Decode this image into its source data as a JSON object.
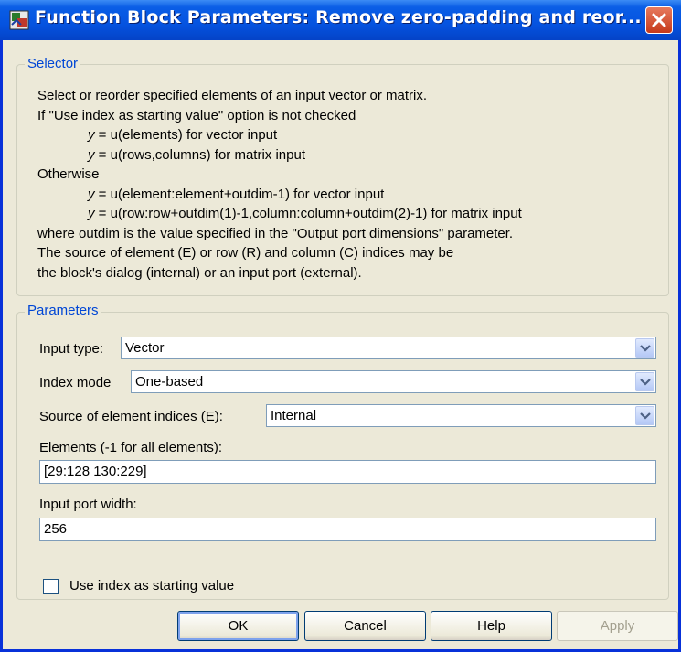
{
  "window": {
    "title": "Function Block Parameters: Remove  zero-padding and reor...",
    "close_icon": "close-icon",
    "app_icon": "simulink-block-icon"
  },
  "selector": {
    "group_label": "Selector",
    "lines": [
      "Select or reorder specified elements of an input vector or matrix.",
      "If \"Use index as starting value\" option is not checked",
      "y = u(elements) for vector input",
      "y = u(rows,columns) for matrix input",
      "Otherwise",
      "y = u(element:element+outdim-1) for vector input",
      "y = u(row:row+outdim(1)-1,column:column+outdim(2)-1) for matrix input",
      "where outdim is the value specified in the \"Output port dimensions\" parameter.",
      "The source of element (E) or row (R) and column (C) indices may be",
      "the block's dialog (internal) or an input port (external)."
    ]
  },
  "parameters": {
    "group_label": "Parameters",
    "input_type": {
      "label": "Input type:",
      "value": "Vector"
    },
    "index_mode": {
      "label": "Index mode",
      "value": "One-based"
    },
    "source_indices": {
      "label": "Source of element indices (E):",
      "value": "Internal"
    },
    "elements": {
      "label": "Elements (-1 for all elements):",
      "value": "[29:128 130:229]"
    },
    "port_width": {
      "label": "Input port width:",
      "value": "256"
    },
    "use_index_checkbox": {
      "label": "Use index as starting value",
      "checked": false
    }
  },
  "buttons": {
    "ok": "OK",
    "cancel": "Cancel",
    "help": "Help",
    "apply": "Apply"
  },
  "colors": {
    "title_bar": "#0553e0",
    "group_label": "#0046d5",
    "dialog_bg": "#ece9d8",
    "close_button": "#c6391a"
  }
}
